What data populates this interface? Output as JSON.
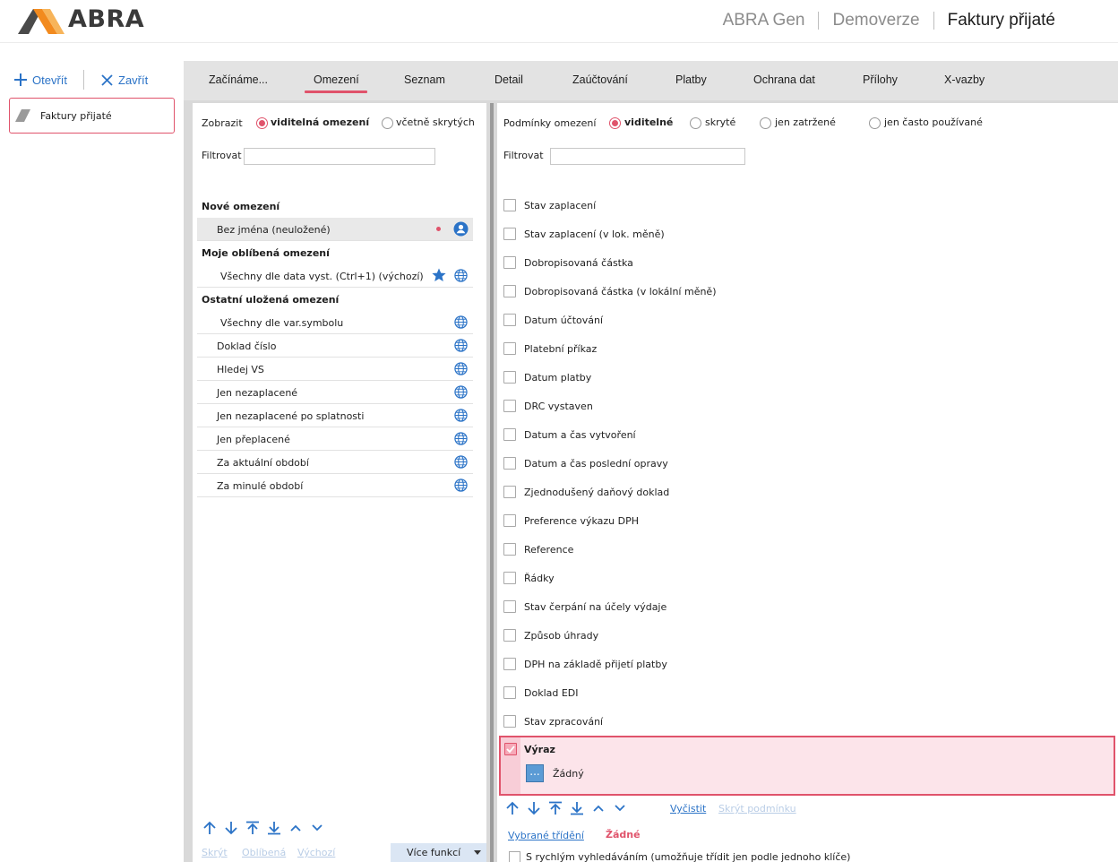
{
  "app": {
    "logo_text": "ABRA",
    "breadcrumbs": [
      "ABRA Gen",
      "Demoverze",
      "Faktury přijaté"
    ]
  },
  "left_actions": {
    "open_label": "Otevřít",
    "close_label": "Zavřít"
  },
  "document_tab": {
    "label": "Faktury přijaté"
  },
  "tabs": [
    {
      "label": "Začínáme..."
    },
    {
      "label": "Omezení"
    },
    {
      "label": "Seznam"
    },
    {
      "label": "Detail"
    },
    {
      "label": "Zaúčtování"
    },
    {
      "label": "Platby"
    },
    {
      "label": "Ochrana dat"
    },
    {
      "label": "Přílohy"
    },
    {
      "label": "X-vazby"
    }
  ],
  "active_tab": "Omezení",
  "left_panel": {
    "show_label": "Zobrazit",
    "show_options": [
      "viditelná omezení",
      "včetně skrytých"
    ],
    "show_selected": "viditelná omezení",
    "filter_label": "Filtrovat",
    "filter_value": "",
    "sections": {
      "new": "Nové omezení",
      "favorites": "Moje oblíbená omezení",
      "other": "Ostatní uložená omezení"
    },
    "new_item": "Bez jména (neuložené)",
    "favorite_item": "Všechny dle data vyst. (Ctrl+1) (výchozí)",
    "other_items": [
      "Všechny dle var.symbolu",
      "Doklad číslo",
      "Hledej VS",
      "Jen nezaplacené",
      "Jen nezaplacené po splatnosti",
      "Jen přeplacené",
      "Za aktuální období",
      "Za minulé období"
    ],
    "bottom_links": [
      "Skrýt",
      "Oblíbená",
      "Výchozí"
    ],
    "more_button": "Více funkcí"
  },
  "right_panel": {
    "conditions_label": "Podmínky omezení",
    "condition_options": [
      "viditelné",
      "skryté",
      "jen zatržené",
      "jen často používané"
    ],
    "condition_selected": "viditelné",
    "filter_label": "Filtrovat",
    "filter_value": "",
    "conditions": [
      "Stav zaplacení",
      "Stav zaplacení (v lok. měně)",
      "Dobropisovaná částka",
      "Dobropisovaná částka (v lokální měně)",
      "Datum účtování",
      "Platební příkaz",
      "Datum platby",
      "DRC vystaven",
      "Datum a čas vytvoření",
      "Datum a čas poslední opravy",
      "Zjednodušený daňový doklad",
      "Preference výkazu DPH",
      "Reference",
      "Řádky",
      "Stav čerpání na účely výdaje",
      "Způsob úhrady",
      "DPH na základě přijetí platby",
      "Doklad EDI",
      "Stav zpracování"
    ],
    "expression": {
      "label": "Výraz",
      "button": "...",
      "value": "Žádný"
    },
    "links": [
      "Vyčistit",
      "Skrýt podmínku"
    ],
    "sort_label": "Vybrané třídění",
    "sort_value": "Žádné",
    "fast_search_label": "S rychlým vyhledáváním (umožňuje třídit jen podle jednoho klíče)"
  },
  "colors": {
    "accent": "#e0536b",
    "link": "#2b73c7",
    "logo_orange": "#f28a1e"
  }
}
